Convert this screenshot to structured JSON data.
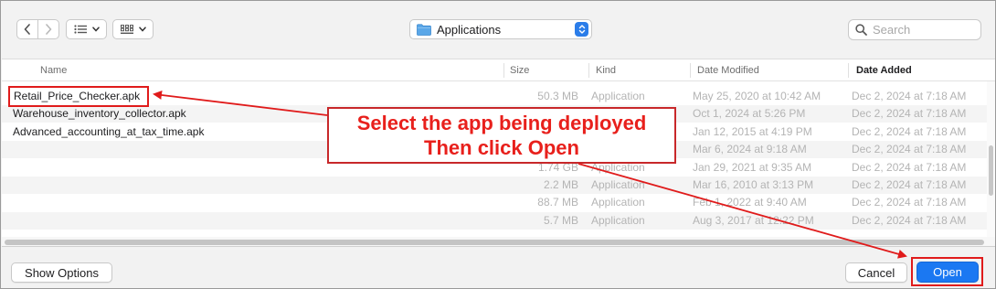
{
  "toolbar": {
    "back_icon": "chevron-left-icon",
    "forward_icon": "chevron-right-icon",
    "list_view_icon": "list-view-icon",
    "grid_view_icon": "grid-view-icon",
    "location": "Applications",
    "search_placeholder": "Search"
  },
  "columns": {
    "name": "Name",
    "size": "Size",
    "kind": "Kind",
    "date_modified": "Date Modified",
    "date_added": "Date Added"
  },
  "rows": [
    {
      "name": "Retail_Price_Checker.apk",
      "size": "50.3 MB",
      "kind": "Application",
      "modified": "May 25, 2020 at 10:42 AM",
      "added": "Dec 2, 2024 at 7:18 AM"
    },
    {
      "name": "Warehouse_inventory_collector.apk",
      "size": "",
      "kind": "",
      "modified": "Oct 1, 2024 at 5:26 PM",
      "added": "Dec 2, 2024 at 7:18 AM"
    },
    {
      "name": "Advanced_accounting_at_tax_time.apk",
      "size": "",
      "kind": "",
      "modified": "Jan 12, 2015 at 4:19 PM",
      "added": "Dec 2, 2024 at 7:18 AM"
    },
    {
      "name": "",
      "size": "",
      "kind": "",
      "modified": "Mar 6, 2024 at 9:18 AM",
      "added": "Dec 2, 2024 at 7:18 AM"
    },
    {
      "name": "",
      "size": "1.74 GB",
      "kind": "Application",
      "modified": "Jan 29, 2021 at 9:35 AM",
      "added": "Dec 2, 2024 at 7:18 AM"
    },
    {
      "name": "",
      "size": "2.2 MB",
      "kind": "Application",
      "modified": "Mar 16, 2010 at 3:13 PM",
      "added": "Dec 2, 2024 at 7:18 AM"
    },
    {
      "name": "",
      "size": "88.7 MB",
      "kind": "Application",
      "modified": "Feb 1, 2022 at 9:40 AM",
      "added": "Dec 2, 2024 at 7:18 AM"
    },
    {
      "name": "",
      "size": "5.7 MB",
      "kind": "Application",
      "modified": "Aug 3, 2017 at 12:22 PM",
      "added": "Dec 2, 2024 at 7:18 AM"
    }
  ],
  "buttons": {
    "show_options": "Show Options",
    "cancel": "Cancel",
    "open": "Open"
  },
  "annotation": {
    "line1": "Select the app being deployed",
    "line2": "Then click Open",
    "color": "#e8201c"
  },
  "colors": {
    "accent": "#1b78f2",
    "folder": "#5aa7e8"
  }
}
